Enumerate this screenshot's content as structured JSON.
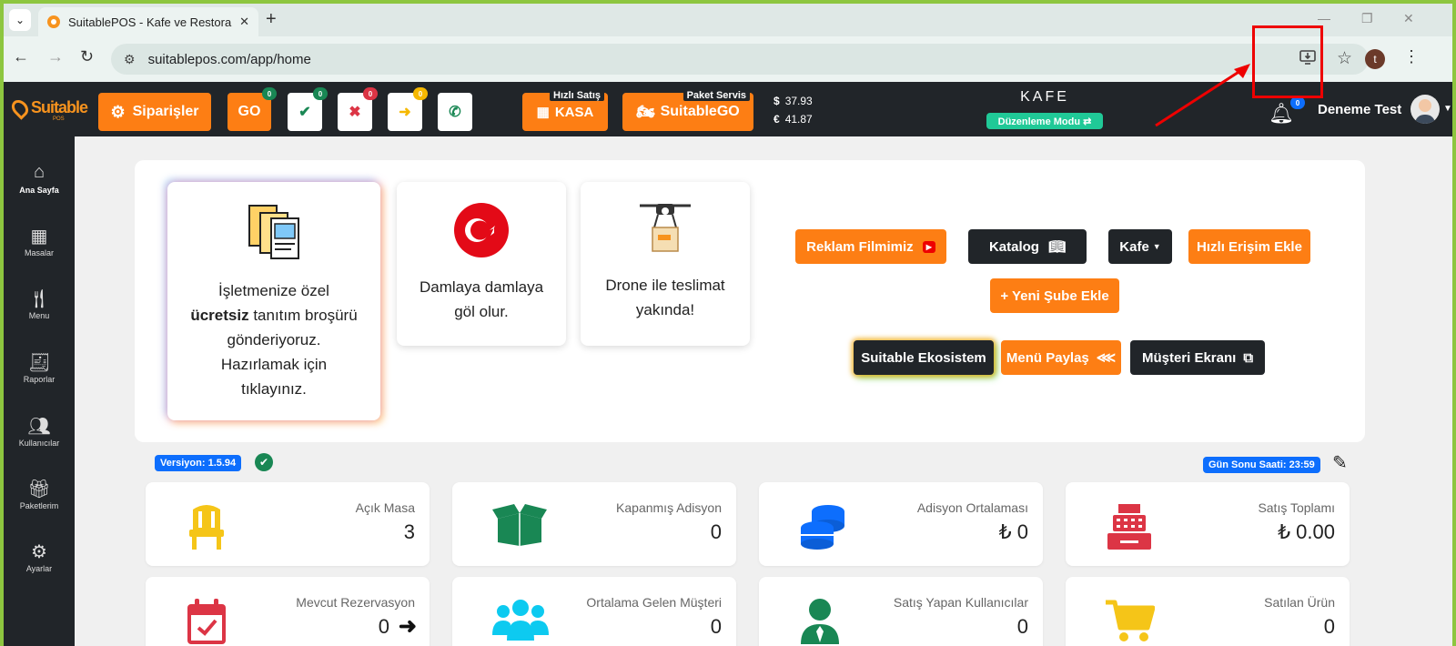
{
  "browser": {
    "tab_title": "SuitablePOS - Kafe ve Restoran",
    "url": "suitablepos.com/app/home",
    "profile_initial": "t"
  },
  "header": {
    "logo_text": "Suitable",
    "logo_sub": "POS",
    "siparisler_label": "Siparişler",
    "go_label": "GO",
    "go_badge": "0",
    "approve_badge": "0",
    "cancel_badge": "0",
    "transfer_badge": "0",
    "kasa_top": "Hızlı Satış",
    "kasa_label": "KASA",
    "paket_top": "Paket Servis",
    "paket_label": "SuitableGO",
    "usd_symbol": "$",
    "usd_rate": "37.93",
    "eur_symbol": "€",
    "eur_rate": "41.87",
    "mode_title": "KAFE",
    "mode_badge": "Düzenleme Modu ⇄",
    "notif_count": "0",
    "user_name": "Deneme Test"
  },
  "sidebar": {
    "items": [
      {
        "label": "Ana Sayfa",
        "icon": "home-icon"
      },
      {
        "label": "Masalar",
        "icon": "table-icon"
      },
      {
        "label": "Menu",
        "icon": "utensils-icon"
      },
      {
        "label": "Raporlar",
        "icon": "receipt-icon"
      },
      {
        "label": "Kullanıcılar",
        "icon": "users-icon"
      },
      {
        "label": "Paketlerim",
        "icon": "gift-icon"
      },
      {
        "label": "Ayarlar",
        "icon": "gears-icon"
      }
    ]
  },
  "promo": {
    "card1_l1": "İşletmenize özel",
    "card1_bold": "ücretsiz",
    "card1_l2": " tanıtım broşürü",
    "card1_l3": "gönderiyoruz.",
    "card1_l4": "Hazırlamak için",
    "card1_l5": "tıklayınız.",
    "card2_l1": "Damlaya damlaya",
    "card2_l2": "göl olur.",
    "card3_l1": "Drone ile teslimat",
    "card3_l2": "yakında!"
  },
  "actions": {
    "reklam": "Reklam Filmimiz",
    "katalog": "Katalog",
    "kafe": "Kafe",
    "hizli": "Hızlı Erişim Ekle",
    "sube": "+ Yeni Şube Ekle",
    "ekosistem": "Suitable Ekosistem",
    "menu_paylas": "Menü Paylaş",
    "musteri": "Müşteri Ekranı"
  },
  "version_label": "Versiyon: 1.5.94",
  "gun_sonu_label": "Gün Sonu Saati: 23:59",
  "stats": [
    {
      "label": "Açık Masa",
      "value": "3",
      "color": "#f5c518"
    },
    {
      "label": "Kapanmış Adisyon",
      "value": "0",
      "color": "#198754"
    },
    {
      "label": "Adisyon Ortalaması",
      "value": "₺ 0",
      "color": "#0d6efd"
    },
    {
      "label": "Satış Toplamı",
      "value": "₺ 0.00",
      "color": "#dc3545"
    },
    {
      "label": "Mevcut Rezervasyon",
      "value": "0",
      "color": "#dc3545"
    },
    {
      "label": "Ortalama Gelen Müşteri",
      "value": "0",
      "color": "#0dcaf0"
    },
    {
      "label": "Satış Yapan Kullanıcılar",
      "value": "0",
      "color": "#198754"
    },
    {
      "label": "Satılan Ürün",
      "value": "0",
      "color": "#f5c518"
    }
  ]
}
